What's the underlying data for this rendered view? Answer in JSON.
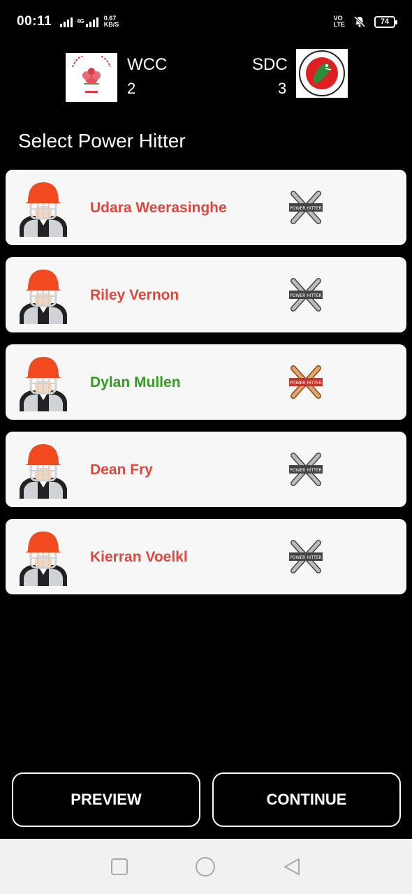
{
  "status_bar": {
    "time": "00:11",
    "network_type": "4G",
    "speed_value": "0.67",
    "speed_unit": "KB/S",
    "volte_top": "VO",
    "volte_bottom": "LTE",
    "battery": "74"
  },
  "match": {
    "home": {
      "abbr": "WCC",
      "score": "2",
      "logo_icon": "waratah-cricket-club-logo"
    },
    "away": {
      "abbr": "SDC",
      "score": "3",
      "logo_icon": "southern-districts-crocodiles-logo"
    }
  },
  "page_title": "Select Power Hitter",
  "players": [
    {
      "name": "Udara Weerasinghe",
      "selected": false
    },
    {
      "name": "Riley Vernon",
      "selected": false
    },
    {
      "name": "Dylan Mullen",
      "selected": true
    },
    {
      "name": "Dean Fry",
      "selected": false
    },
    {
      "name": "Kierran Voelkl",
      "selected": false
    }
  ],
  "power_hitter_badge_text": "POWER HITTER",
  "colors": {
    "unselected_name": "#e0483e",
    "selected_name": "#2ea01c",
    "helmet": "#f04a1e",
    "badge_active": "#c0392b"
  },
  "buttons": {
    "preview": "PREVIEW",
    "continue": "CONTINUE"
  }
}
